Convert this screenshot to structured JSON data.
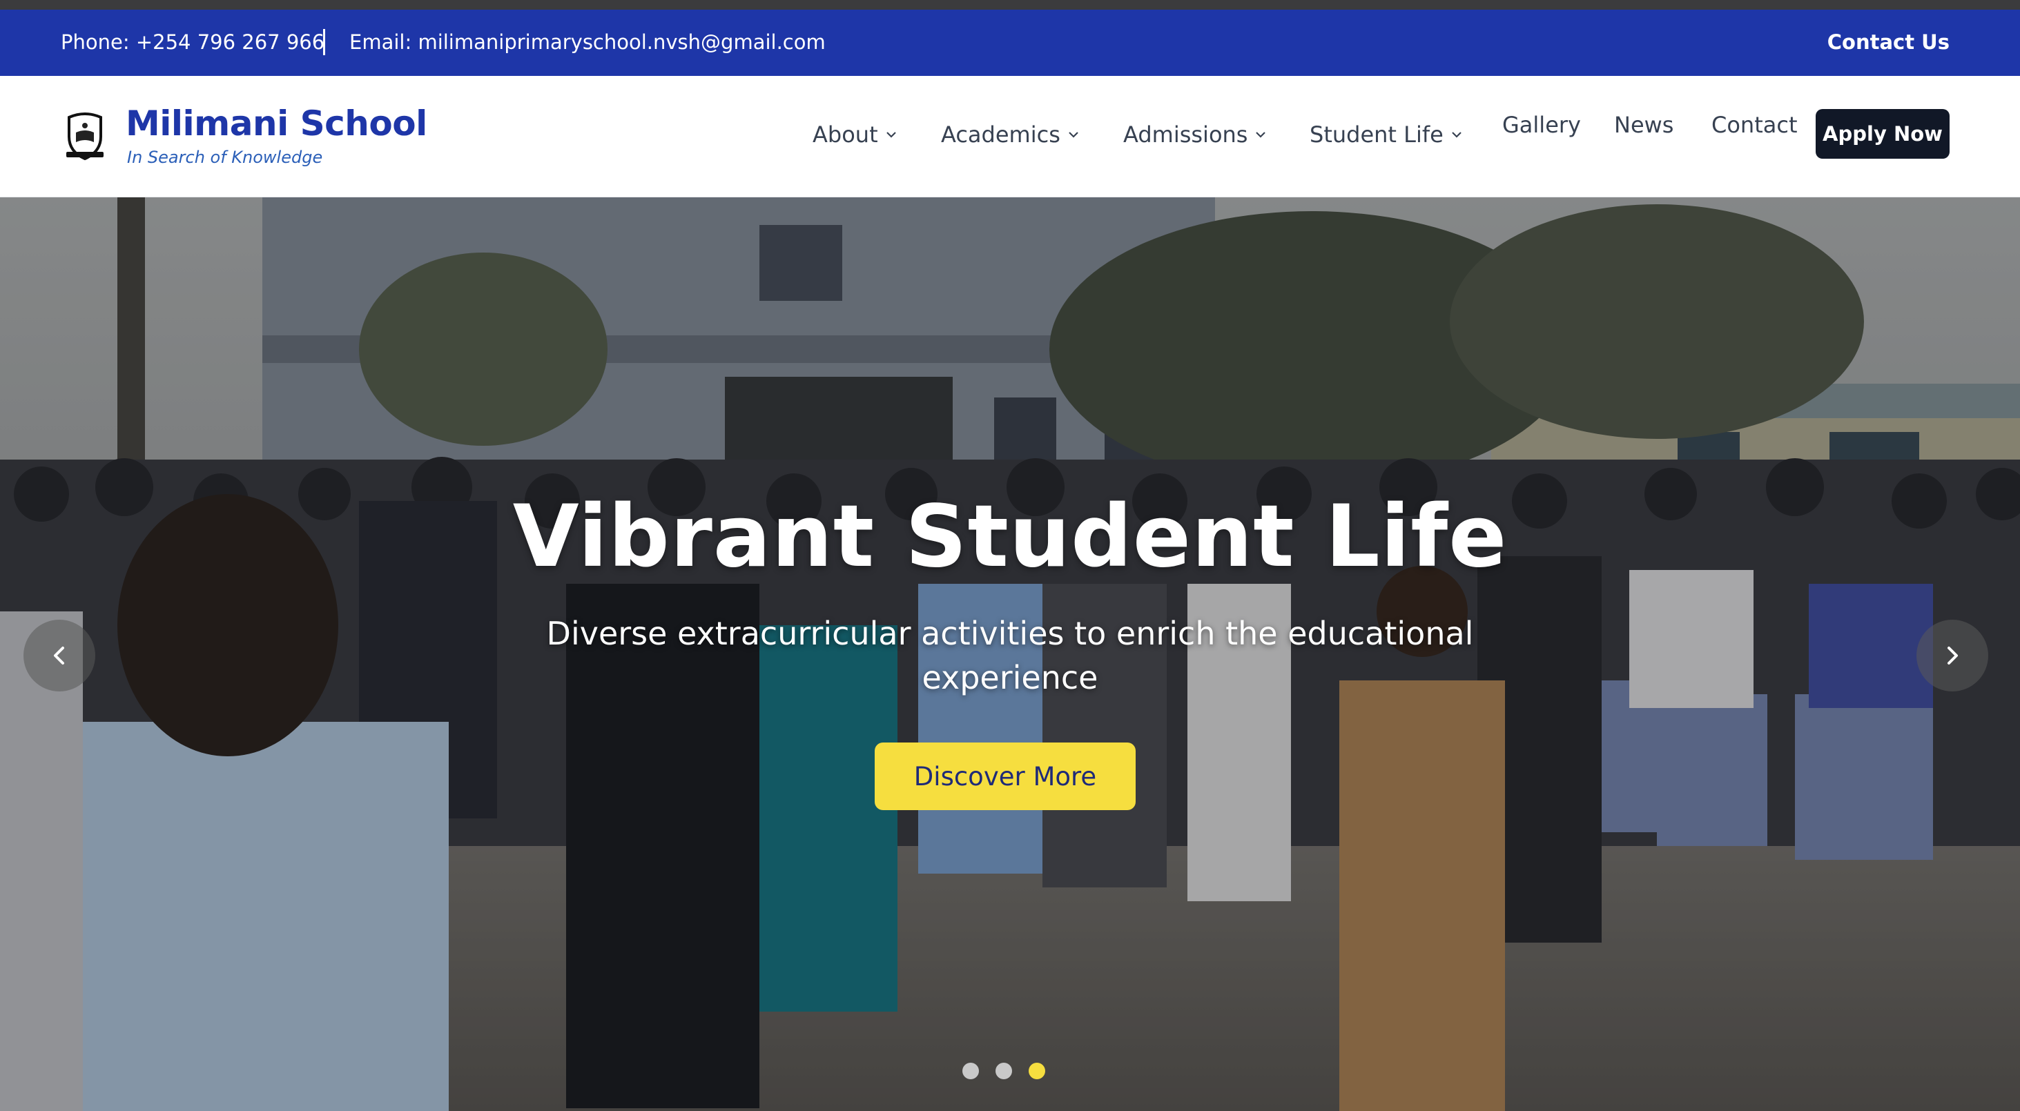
{
  "topbar": {
    "phone": "Phone: +254 796 267 966",
    "email": "Email: milimaniprimaryschool.nvsh@gmail.com",
    "contact": "Contact Us"
  },
  "brand": {
    "name": "Milimani School",
    "tagline": "In Search of Knowledge"
  },
  "nav": {
    "items": [
      {
        "label": "About",
        "dropdown": true
      },
      {
        "label": "Academics",
        "dropdown": true
      },
      {
        "label": "Admissions",
        "dropdown": true
      },
      {
        "label": "Student Life",
        "dropdown": true
      },
      {
        "label": "Gallery",
        "dropdown": false
      },
      {
        "label": "News",
        "dropdown": false
      },
      {
        "label": "Contact",
        "dropdown": false
      }
    ],
    "cta": "Apply Now"
  },
  "hero": {
    "title": "Vibrant Student Life",
    "subtitle": "Diverse extracurricular activities to enrich the educational experience",
    "button": "Discover More",
    "slides_total": 3,
    "active_slide": 3
  },
  "icons": {
    "crest": "school-crest-icon",
    "prev": "chevron-left-icon",
    "next": "chevron-right-icon",
    "dropdown": "chevron-down-icon"
  },
  "colors": {
    "brand_blue": "#1e36a8",
    "accent_yellow": "#f6de3f",
    "dark_button": "#111827"
  }
}
